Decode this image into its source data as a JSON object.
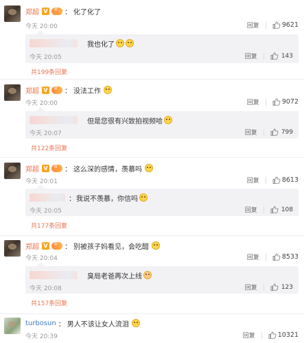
{
  "comments": [
    {
      "user": "郑超",
      "text": "化了化了",
      "time": "今天 20:00",
      "reply_label": "回复",
      "likes": "9621",
      "reply": {
        "text": "我也化了",
        "time": "今天 20:05",
        "reply_label": "回复",
        "likes": "143"
      },
      "reply_count": "共199条回复"
    },
    {
      "user": "郑超",
      "text": "没法工作",
      "time": "今天 20:00",
      "reply_label": "回复",
      "likes": "9072",
      "reply": {
        "text": "但是您很有兴致拍视频哈",
        "time": "今天 20:07",
        "reply_label": "回复",
        "likes": "799"
      },
      "reply_count": "共122条回复"
    },
    {
      "user": "郑超",
      "text": "这么深的感情，羡慕吗",
      "time": "今天 20:01",
      "reply_label": "回复",
      "likes": "8613",
      "reply": {
        "text": "我说不羡慕，你信吗",
        "time": "今天 20:05",
        "reply_label": "回复",
        "likes": "108"
      },
      "reply_count": "共177条回复"
    },
    {
      "user": "郑超",
      "text": "别被孩子妈看见，会吃醋",
      "time": "今天 20:04",
      "reply_label": "回复",
      "likes": "8533",
      "reply": {
        "text": "臭局老爸再次上线",
        "time": "今天 20:08",
        "reply_label": "回复",
        "likes": "123"
      },
      "reply_count": "共157条回复"
    },
    {
      "user": "turbosun",
      "text": "男人不该让女人流泪",
      "time": "今天 20:39",
      "reply_label": "回复",
      "likes": "10321"
    }
  ],
  "icons": {
    "like": "thumbs-up-icon",
    "verified": "verified-v-icon",
    "vip": "vip-crown-icon",
    "emoji": "cat-emoji-icon"
  },
  "colors": {
    "username": "#eb7350",
    "username_alt": "#3c7bc0",
    "reply_bg": "#f2f2f5",
    "reply_count": "#eb7350",
    "time": "#999999"
  }
}
